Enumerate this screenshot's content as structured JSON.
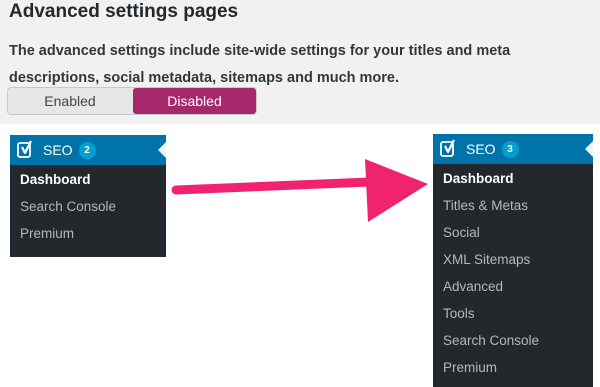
{
  "settings": {
    "heading": "Advanced settings pages",
    "description": "The advanced settings include site-wide settings for your titles and meta descriptions, social metadata, sitemaps and much more.",
    "toggle": {
      "enabled_label": "Enabled",
      "disabled_label": "Disabled",
      "selected": "Disabled"
    }
  },
  "menu_before": {
    "title": "SEO",
    "badge": "2",
    "items": [
      "Dashboard",
      "Search Console",
      "Premium"
    ],
    "current": "Dashboard"
  },
  "menu_after": {
    "title": "SEO",
    "badge": "3",
    "items": [
      "Dashboard",
      "Titles & Metas",
      "Social",
      "XML Sitemaps",
      "Advanced",
      "Tools",
      "Search Console",
      "Premium"
    ],
    "current": "Dashboard"
  },
  "colors": {
    "toggle_active": "#a4286a",
    "menu_header": "#0073aa",
    "menu_background": "#23282d",
    "badge": "#00a0d2",
    "arrow": "#f0246e"
  },
  "icons": {
    "menu_icon": "yoast-seo-icon",
    "transition": "right-arrow-icon"
  }
}
